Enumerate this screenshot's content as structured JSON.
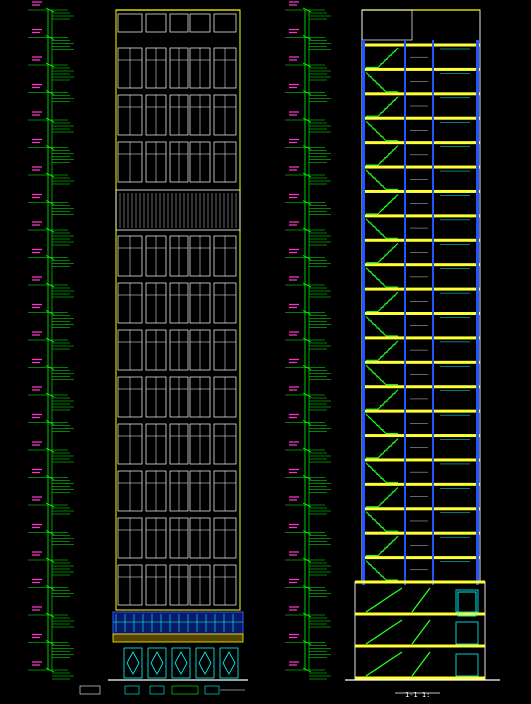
{
  "drawing": {
    "colors": {
      "background": "#000000",
      "outline": "#ffffff",
      "frame": "#ffff00",
      "dimension": "#00ff00",
      "level_text": "#ff33cc",
      "glazing": "#00ffff",
      "storefront": "#3355ff",
      "section_fill": "#ffff33",
      "stair": "#22ff22",
      "column": "#2255ff"
    },
    "elevation": {
      "floor_count": 24,
      "window_rows_upper": 3,
      "window_rows_lower": 8,
      "window_columns": 5
    },
    "section": {
      "floor_count": 22,
      "lower_floors": 3
    },
    "labels": {
      "section_title": "1-1 1:"
    }
  }
}
